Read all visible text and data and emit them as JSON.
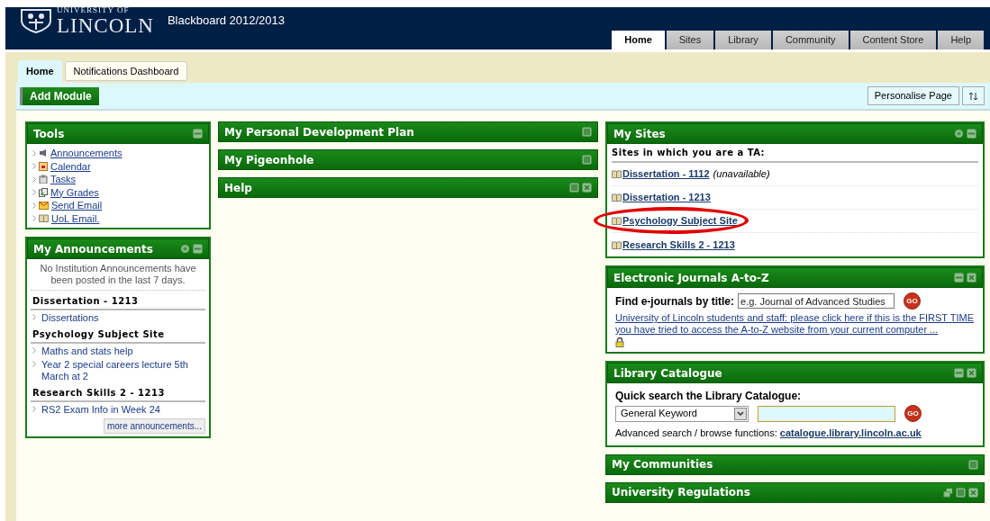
{
  "header": {
    "logo_top": "UNIVERSITY OF",
    "logo_name": "LINCOLN",
    "title": "Blackboard 2012/2013",
    "tabs": [
      {
        "label": "Home",
        "selected": true
      },
      {
        "label": "Sites",
        "selected": false
      },
      {
        "label": "Library",
        "selected": false
      },
      {
        "label": "Community",
        "selected": false
      },
      {
        "label": "Content Store",
        "selected": false
      },
      {
        "label": "Help",
        "selected": false
      }
    ]
  },
  "page_tabs": [
    {
      "label": "Home",
      "selected": true
    },
    {
      "label": "Notifications Dashboard",
      "selected": false
    }
  ],
  "toolbar": {
    "add_button": "Add Module",
    "personalise_button": "Personalise Page"
  },
  "columns": [
    {
      "modules": [
        {
          "kind": "tools",
          "title": "Tools",
          "controls": [
            {
              "kind": "minimize"
            }
          ],
          "items": [
            {
              "label": "Announcements"
            },
            {
              "label": "Calendar"
            },
            {
              "label": "Tasks"
            },
            {
              "label": "My Grades"
            },
            {
              "label": "Send Email"
            },
            {
              "label": "UoL Email."
            }
          ]
        },
        {
          "kind": "announcements",
          "title": "My Announcements",
          "controls": [
            {
              "kind": "settings"
            },
            {
              "kind": "minimize"
            }
          ],
          "notice": "No Institution Announcements have been posted in the last 7 days.",
          "groups": [
            {
              "heading": "Dissertation - 1213",
              "items": [
                "Dissertations"
              ]
            },
            {
              "heading": "Psychology Subject Site",
              "items": [
                "Maths and stats help",
                "Year 2 special careers lecture 5th March at 2"
              ]
            },
            {
              "heading": "Research Skills 2 - 1213",
              "items": [
                "RS2 Exam Info in Week 24"
              ]
            }
          ],
          "more": "more announcements..."
        }
      ]
    },
    {
      "modules": [
        {
          "kind": "collapsed",
          "title": "My Personal Development Plan",
          "controls": [
            {
              "kind": "restore"
            }
          ]
        },
        {
          "kind": "collapsed",
          "title": "My Pigeonhole",
          "controls": [
            {
              "kind": "restore"
            }
          ]
        },
        {
          "kind": "collapsed",
          "title": "Help",
          "controls": [
            {
              "kind": "restore"
            },
            {
              "kind": "close"
            }
          ]
        }
      ]
    },
    {
      "modules": [
        {
          "kind": "sites",
          "title": "My Sites",
          "controls": [
            {
              "kind": "settings"
            },
            {
              "kind": "minimize"
            }
          ],
          "heading": "Sites in which you are a TA:",
          "sites": [
            {
              "label": "Dissertation - 1112",
              "note": "(unavailable)",
              "circled": false
            },
            {
              "label": "Dissertation - 1213",
              "circled": false
            },
            {
              "label": "Psychology Subject Site",
              "circled": true
            },
            {
              "label": "Research Skills 2 - 1213",
              "circled": false
            }
          ]
        },
        {
          "kind": "journals",
          "title": "Electronic Journals A-to-Z",
          "controls": [
            {
              "kind": "minimize"
            },
            {
              "kind": "close"
            }
          ],
          "label": "Find e-journals by title:",
          "placeholder": "e.g. Journal of Advanced Studies",
          "go": "GO",
          "link": "University of Lincoln students and staff: please click here if this is the FIRST TIME you have tried to access the A-to-Z website from your current computer ..."
        },
        {
          "kind": "catalogue",
          "title": "Library Catalogue",
          "controls": [
            {
              "kind": "minimize"
            },
            {
              "kind": "close"
            }
          ],
          "label": "Quick search the Library Catalogue:",
          "select": "General Keyword",
          "go": "GO",
          "advanced": "Advanced search / browse functions:",
          "link": "catalogue.library.lincoln.ac.uk"
        },
        {
          "kind": "collapsed",
          "title": "My Communities",
          "controls": [
            {
              "kind": "restore"
            }
          ]
        },
        {
          "kind": "collapsed",
          "title": "University Regulations",
          "controls": [
            {
              "kind": "move"
            },
            {
              "kind": "restore"
            },
            {
              "kind": "close"
            }
          ]
        }
      ]
    }
  ]
}
